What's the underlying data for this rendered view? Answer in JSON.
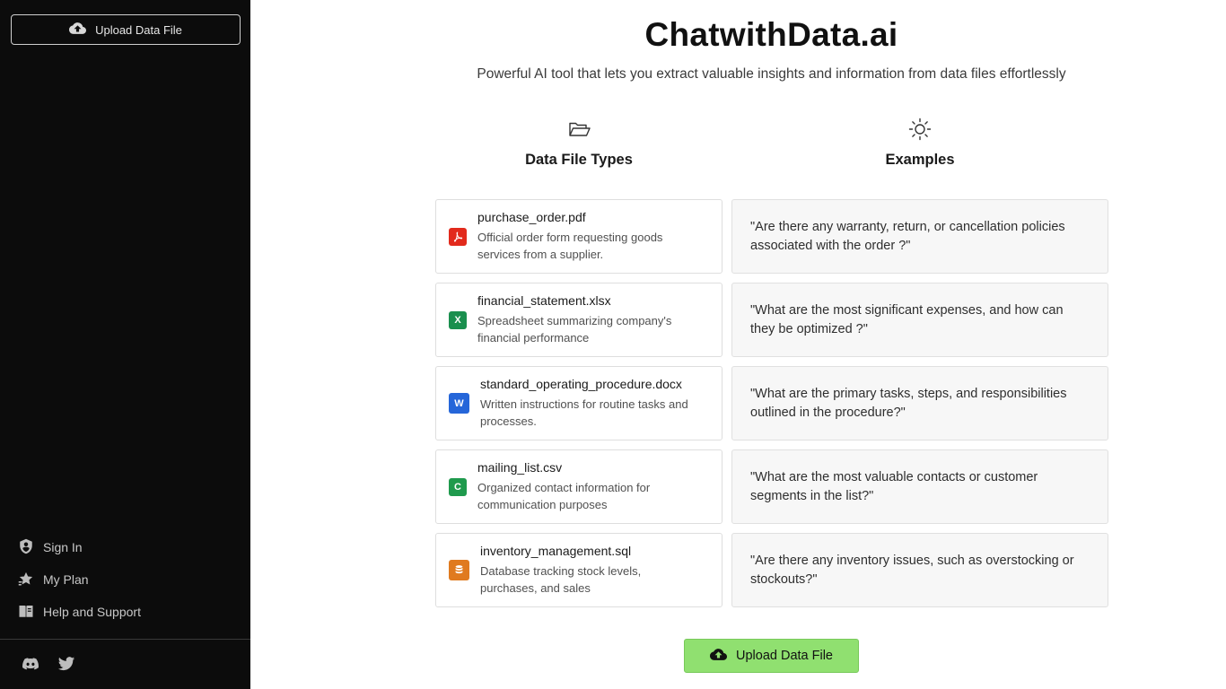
{
  "sidebar": {
    "upload_label": "Upload Data File",
    "nav": [
      {
        "label": "Sign In",
        "icon": "shield-icon"
      },
      {
        "label": "My Plan",
        "icon": "star-icon"
      },
      {
        "label": "Help and Support",
        "icon": "book-icon"
      }
    ],
    "social": [
      "discord-icon",
      "twitter-icon"
    ]
  },
  "main": {
    "title": "ChatwithData.ai",
    "subtitle": "Powerful AI tool that lets you extract valuable insights and information from data files effortlessly",
    "columns": {
      "types_label": "Data File Types",
      "types_icon": "folder-open-icon",
      "examples_label": "Examples",
      "examples_icon": "sun-icon"
    },
    "files": [
      {
        "name": "purchase_order.pdf",
        "description": "Official order form requesting goods services from a supplier.",
        "icon": "pdf-icon",
        "color": "#e22a1c",
        "glyph": ""
      },
      {
        "name": "financial_statement.xlsx",
        "description": "Spreadsheet summarizing company's financial performance",
        "icon": "excel-icon",
        "color": "#1a8f4e",
        "glyph": "X"
      },
      {
        "name": "standard_operating_procedure.docx",
        "description": "Written instructions for routine tasks and processes.",
        "icon": "word-icon",
        "color": "#2566d9",
        "glyph": "W"
      },
      {
        "name": "mailing_list.csv",
        "description": "Organized contact information for communication purposes",
        "icon": "csv-icon",
        "color": "#1f9a4d",
        "glyph": "C"
      },
      {
        "name": "inventory_management.sql",
        "description": "Database tracking stock levels, purchases, and sales",
        "icon": "database-icon",
        "color": "#e07a1f",
        "glyph": ""
      }
    ],
    "examples": [
      "\"Are there any warranty, return, or cancellation policies associated with the order ?\"",
      "\"What are the most significant expenses, and how can they be optimized ?\"",
      "\"What are the primary tasks, steps, and responsibilities outlined in the procedure?\"",
      "\"What are the most valuable contacts or customer segments in the list?\"",
      "\"Are there any inventory issues, such as overstocking or stockouts?\""
    ],
    "upload_label": "Upload Data File",
    "upload_color": "#90e070"
  }
}
